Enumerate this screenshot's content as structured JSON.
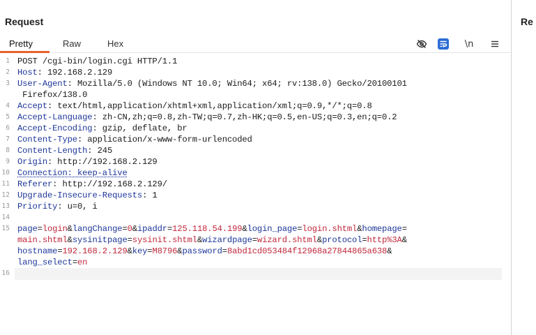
{
  "left_panel": {
    "title": "Request",
    "tabs": [
      {
        "label": "Pretty",
        "active": true
      },
      {
        "label": "Raw",
        "active": false
      },
      {
        "label": "Hex",
        "active": false
      }
    ],
    "toolbar": {
      "hide_icon": "eye-slash-icon",
      "wrap_icon": "word-wrap-icon",
      "newline_label": "\\n",
      "menu_icon": "hamburger-menu-icon"
    }
  },
  "right_panel": {
    "title": "Re"
  },
  "colors": {
    "accent": "#e8612c",
    "key": "#1e3799",
    "value": "#c0283c",
    "wrap_button": "#2b6cd4"
  },
  "lines": [
    {
      "n": "1",
      "parts": [
        {
          "t": "POST /cgi-bin/login.cgi HTTP/1.1",
          "c": "d"
        }
      ]
    },
    {
      "n": "2",
      "parts": [
        {
          "t": "Host",
          "c": "k"
        },
        {
          "t": ": 192.168.2.129",
          "c": "d"
        }
      ]
    },
    {
      "n": "3",
      "parts": [
        {
          "t": "User-Agent",
          "c": "k"
        },
        {
          "t": ": Mozilla/5.0 (Windows NT 10.0; Win64; x64; rv:138.0) Gecko/20100101",
          "c": "d"
        }
      ]
    },
    {
      "n": "",
      "parts": [
        {
          "t": " Firefox/138.0",
          "c": "d"
        }
      ]
    },
    {
      "n": "4",
      "parts": [
        {
          "t": "Accept",
          "c": "k"
        },
        {
          "t": ": text/html,application/xhtml+xml,application/xml;q=0.9,*/*;q=0.8",
          "c": "d"
        }
      ]
    },
    {
      "n": "5",
      "parts": [
        {
          "t": "Accept-Language",
          "c": "k"
        },
        {
          "t": ": zh-CN,zh;q=0.8,zh-TW;q=0.7,zh-HK;q=0.5,en-US;q=0.3,en;q=0.2",
          "c": "d"
        }
      ]
    },
    {
      "n": "6",
      "parts": [
        {
          "t": "Accept-Encoding",
          "c": "k"
        },
        {
          "t": ": gzip, deflate, br",
          "c": "d"
        }
      ]
    },
    {
      "n": "7",
      "parts": [
        {
          "t": "Content-Type",
          "c": "k"
        },
        {
          "t": ": application/x-www-form-urlencoded",
          "c": "d"
        }
      ]
    },
    {
      "n": "8",
      "parts": [
        {
          "t": "Content-Length",
          "c": "k"
        },
        {
          "t": ": 245",
          "c": "d"
        }
      ]
    },
    {
      "n": "9",
      "parts": [
        {
          "t": "Origin",
          "c": "k"
        },
        {
          "t": ": http://192.168.2.129",
          "c": "d"
        }
      ]
    },
    {
      "n": "10",
      "parts": [
        {
          "t": "Connection: keep-alive",
          "c": "k dotted"
        }
      ]
    },
    {
      "n": "11",
      "parts": [
        {
          "t": "Referer",
          "c": "k"
        },
        {
          "t": ": http://192.168.2.129/",
          "c": "d"
        }
      ]
    },
    {
      "n": "12",
      "parts": [
        {
          "t": "Upgrade-Insecure-Requests",
          "c": "k"
        },
        {
          "t": ": 1",
          "c": "d"
        }
      ]
    },
    {
      "n": "13",
      "parts": [
        {
          "t": "Priority",
          "c": "k"
        },
        {
          "t": ": u=0, i",
          "c": "d"
        }
      ]
    },
    {
      "n": "14",
      "parts": []
    },
    {
      "n": "15",
      "parts": [
        {
          "t": "page",
          "c": "k"
        },
        {
          "t": "=",
          "c": "d"
        },
        {
          "t": "login",
          "c": "v"
        },
        {
          "t": "&",
          "c": "d"
        },
        {
          "t": "langChange",
          "c": "k"
        },
        {
          "t": "=",
          "c": "d"
        },
        {
          "t": "0",
          "c": "v"
        },
        {
          "t": "&",
          "c": "d"
        },
        {
          "t": "ipaddr",
          "c": "k"
        },
        {
          "t": "=",
          "c": "d"
        },
        {
          "t": "125.118.54.199",
          "c": "v"
        },
        {
          "t": "&",
          "c": "d"
        },
        {
          "t": "login_page",
          "c": "k"
        },
        {
          "t": "=",
          "c": "d"
        },
        {
          "t": "login.shtml",
          "c": "v"
        },
        {
          "t": "&",
          "c": "d"
        },
        {
          "t": "homepage",
          "c": "k"
        },
        {
          "t": "=",
          "c": "d"
        }
      ]
    },
    {
      "n": "",
      "parts": [
        {
          "t": "main.shtml",
          "c": "v"
        },
        {
          "t": "&",
          "c": "d"
        },
        {
          "t": "sysinitpage",
          "c": "k"
        },
        {
          "t": "=",
          "c": "d"
        },
        {
          "t": "sysinit.shtml",
          "c": "v"
        },
        {
          "t": "&",
          "c": "d"
        },
        {
          "t": "wizardpage",
          "c": "k"
        },
        {
          "t": "=",
          "c": "d"
        },
        {
          "t": "wizard.shtml",
          "c": "v"
        },
        {
          "t": "&",
          "c": "d"
        },
        {
          "t": "protocol",
          "c": "k"
        },
        {
          "t": "=",
          "c": "d"
        },
        {
          "t": "http%3A",
          "c": "v"
        },
        {
          "t": "&",
          "c": "d"
        }
      ]
    },
    {
      "n": "",
      "parts": [
        {
          "t": "hostname",
          "c": "k"
        },
        {
          "t": "=",
          "c": "d"
        },
        {
          "t": "192.168.2.129",
          "c": "v"
        },
        {
          "t": "&",
          "c": "d"
        },
        {
          "t": "key",
          "c": "k"
        },
        {
          "t": "=",
          "c": "d"
        },
        {
          "t": "M8796",
          "c": "v"
        },
        {
          "t": "&",
          "c": "d"
        },
        {
          "t": "password",
          "c": "k"
        },
        {
          "t": "=",
          "c": "d"
        },
        {
          "t": "8abd1cd053484f12968a27844865a638",
          "c": "v"
        },
        {
          "t": "&",
          "c": "d"
        }
      ]
    },
    {
      "n": "",
      "parts": [
        {
          "t": "lang_select",
          "c": "k"
        },
        {
          "t": "=",
          "c": "d"
        },
        {
          "t": "en",
          "c": "v"
        }
      ]
    },
    {
      "n": "16",
      "parts": [],
      "highlight": true
    }
  ]
}
